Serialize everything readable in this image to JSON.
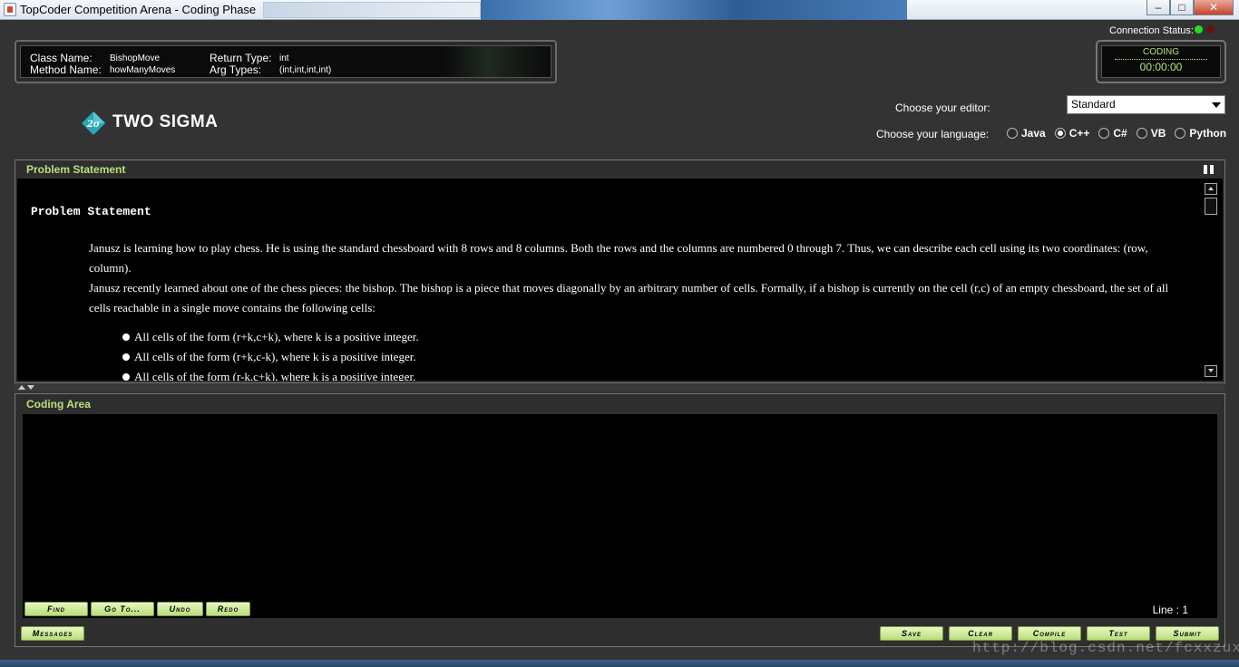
{
  "window": {
    "title": "TopCoder Competition Arena - Coding Phase",
    "buttons": {
      "minimize": "–",
      "maximize": "□",
      "close": "✕"
    }
  },
  "problem_info": {
    "class_name_label": "Class Name:",
    "class_name": "BishopMove",
    "method_name_label": "Method Name:",
    "method_name": "howManyMoves",
    "return_type_label": "Return Type:",
    "return_type": "int",
    "arg_types_label": "Arg Types:",
    "arg_types": "(int,int,int,int)"
  },
  "connection": {
    "label": "Connection Status:",
    "colors": {
      "ok": "#22dd22",
      "off": "#661111"
    }
  },
  "timer": {
    "status": "CODING",
    "time": "00:00:00"
  },
  "logo": {
    "mark": "2σ",
    "text": "TWO SIGMA",
    "icon": "two-sigma-logo-icon"
  },
  "editor": {
    "label": "Choose your editor:",
    "selected": "Standard"
  },
  "language": {
    "label": "Choose your language:",
    "options": [
      {
        "label": "Java",
        "selected": false
      },
      {
        "label": "C++",
        "selected": true
      },
      {
        "label": "C#",
        "selected": false
      },
      {
        "label": "VB",
        "selected": false
      },
      {
        "label": "Python",
        "selected": false
      }
    ]
  },
  "problem_panel": {
    "header": "Problem Statement",
    "heading": "Problem Statement",
    "paragraphs": [
      "Janusz is learning how to play chess. He is using the standard chessboard with 8 rows and 8 columns. Both the rows and the columns are numbered 0 through 7. Thus, we can describe each cell using its two coordinates: (row, column).",
      "Janusz recently learned about one of the chess pieces: the bishop. The bishop is a piece that moves diagonally by an arbitrary number of cells. Formally, if a bishop is currently on the cell (r,c) of an empty chessboard, the set of all cells reachable in a single move contains the following cells:"
    ],
    "bullets": [
      "All cells of the form (r+k,c+k), where k is a positive integer.",
      "All cells of the form (r+k,c-k), where k is a positive integer.",
      "All cells of the form (r-k,c+k), where k is a positive integer."
    ]
  },
  "coding_panel": {
    "header": "Coding Area",
    "line_label": "Line : 1",
    "edit_buttons": {
      "find": "Find",
      "goto": "Go To...",
      "undo": "Undo",
      "redo": "Redo"
    },
    "messages": "Messages",
    "action_buttons": {
      "save": "Save",
      "clear": "Clear",
      "compile": "Compile",
      "test": "Test",
      "submit": "Submit"
    }
  },
  "watermark": "http://blog.csdn.net/fcxxzux",
  "colors": {
    "accent_green": "#b9e07b",
    "background": "#333333",
    "logo_teal": "#2aa6b8"
  }
}
